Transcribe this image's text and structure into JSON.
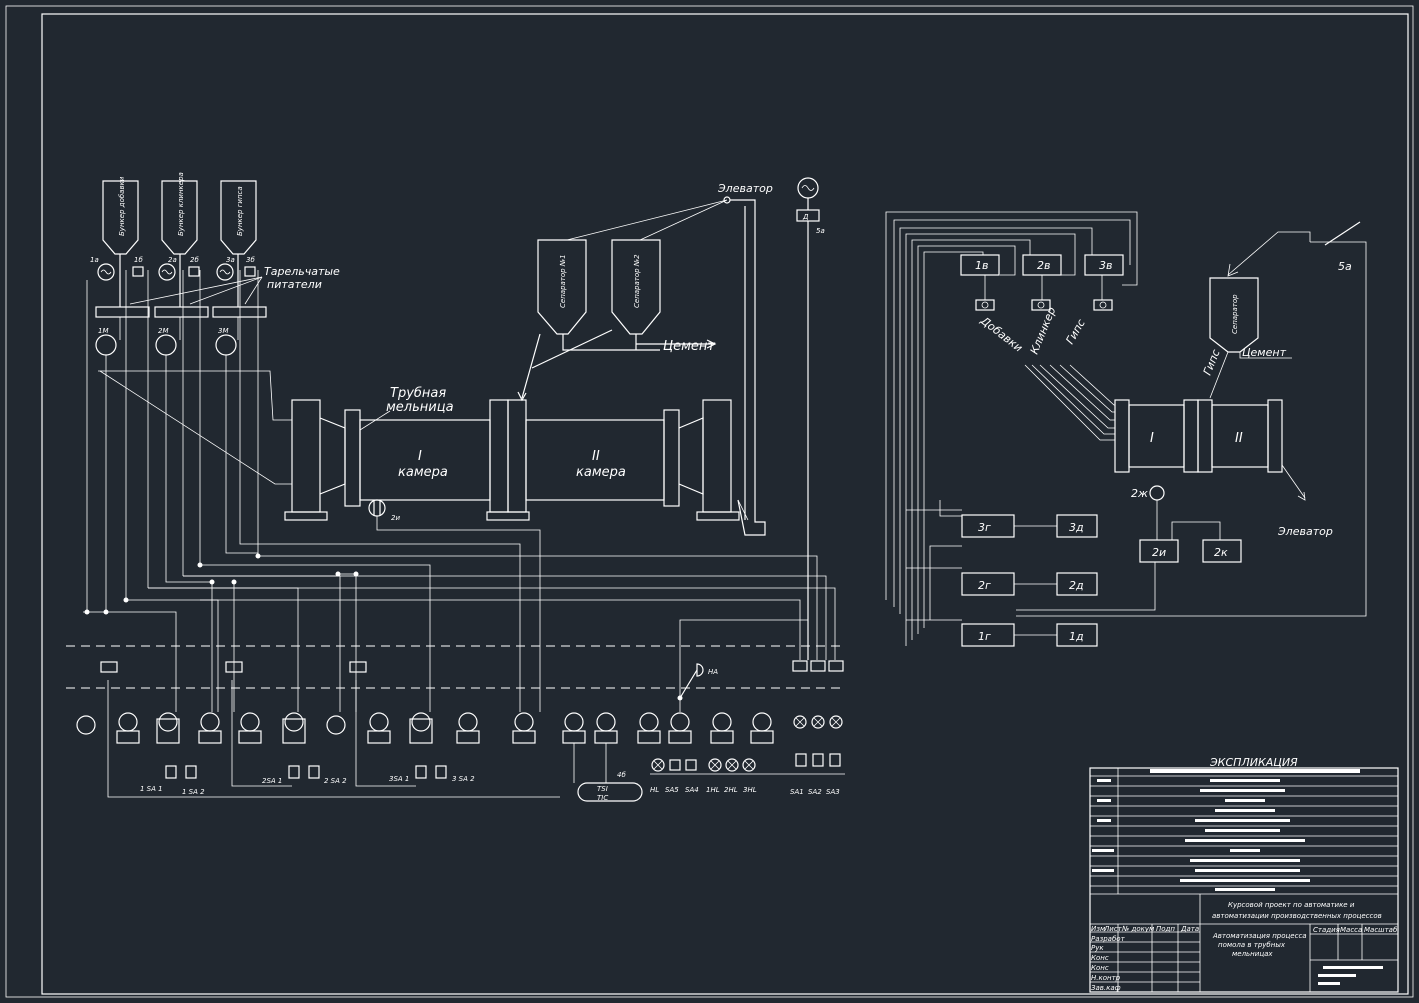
{
  "left_scheme": {
    "bunkers": [
      "Бункер добавки",
      "Бункер клинкера",
      "Бункер гипса"
    ],
    "feeders_label": [
      "Тарельчатые",
      "питатели"
    ],
    "elevator": "Элеватор",
    "separators": [
      "Сепаратор №1",
      "Сепаратор №2"
    ],
    "cement": "Цемент",
    "mill_label": [
      "Трубная",
      "мельница"
    ],
    "chamber1": [
      "I",
      "камера"
    ],
    "chamber2": [
      "II",
      "камера"
    ],
    "tags_top": [
      "1а",
      "1б",
      "2а",
      "2б",
      "3а",
      "3б",
      "1М",
      "2М",
      "3М",
      "5а",
      "2и"
    ],
    "gen_box": "Д",
    "switch_labels": [
      "1 SA 1",
      "1 SA 2",
      "2SA 1",
      "2 SA 2",
      "3SA 1",
      "3 SA 2"
    ],
    "lamp_labels": [
      "HL",
      "SA5",
      "SA4",
      "1HL",
      "2HL",
      "3HL",
      "SA1",
      "SA2",
      "SA3"
    ],
    "horn_label": "HA",
    "recorder": [
      "TSI",
      "TIC"
    ],
    "recorder_tag": "4б"
  },
  "right_scheme": {
    "controllers": [
      "1в",
      "2в",
      "3в"
    ],
    "material_labels": [
      "Добавки",
      "Клинкер",
      "Гипс"
    ],
    "separator": "Сепаратор",
    "gips": "Гипс",
    "cement": "Цемент",
    "chamber_labels": [
      "I",
      "II"
    ],
    "elevator": "Элеватор",
    "blocks": [
      "3г",
      "3д",
      "2г",
      "2д",
      "1г",
      "1д",
      "2и",
      "2к"
    ],
    "sensor_tag": "2ж",
    "tag_5a": "5а"
  },
  "title_block": {
    "heading": "ЭКСПЛИКАЦИЯ",
    "project_line1": "Курсовой проект по автоматике и",
    "project_line2": "автоматизации производственных процессов",
    "doc_title": [
      "Автоматизация процесса",
      "помола в трубных",
      "мельницах"
    ],
    "headers": [
      "Изм",
      "Лист",
      "№ докум",
      "Подп",
      "Дата"
    ],
    "roles": [
      "Разработ",
      "Рук",
      "Конс",
      "Конс",
      "Н.контр",
      "Зав.каф"
    ],
    "stage_cols": [
      "Стадия",
      "Масса",
      "Масштаб"
    ]
  }
}
